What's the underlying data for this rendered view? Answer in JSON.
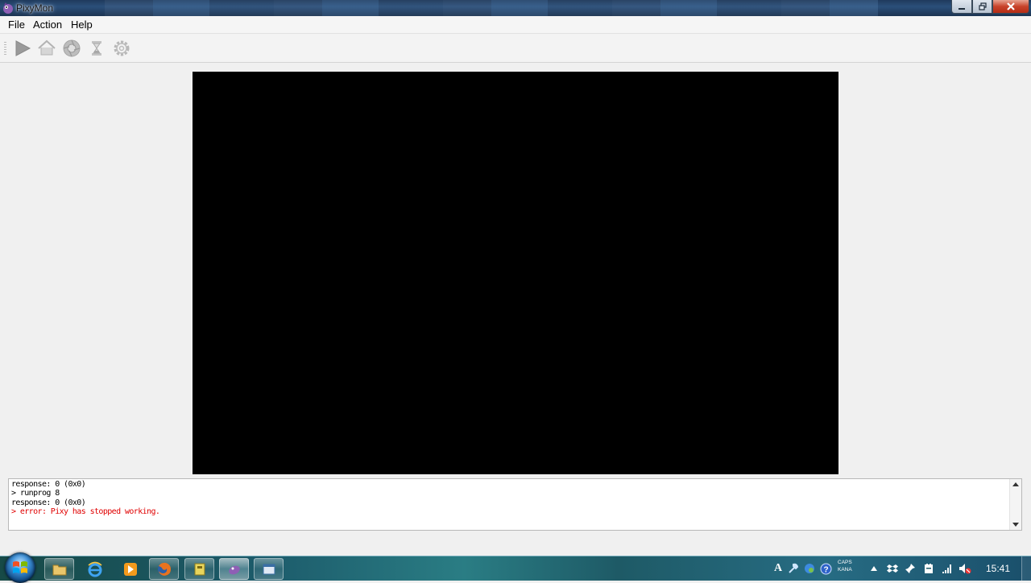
{
  "window": {
    "title": "PixyMon",
    "controls": [
      "minimize",
      "maximize",
      "close"
    ]
  },
  "menu": {
    "items": [
      "File",
      "Action",
      "Help"
    ]
  },
  "toolbar": {
    "buttons": [
      {
        "name": "run",
        "icon": "play-icon"
      },
      {
        "name": "default-program",
        "icon": "home-icon"
      },
      {
        "name": "raw-video",
        "icon": "camera-icon"
      },
      {
        "name": "set-signature",
        "icon": "hourglass-icon"
      },
      {
        "name": "configure",
        "icon": "gear-icon"
      }
    ]
  },
  "video": {
    "background": "#000000"
  },
  "console": {
    "lines": [
      {
        "text": "response: 0 (0x0)",
        "type": "normal"
      },
      {
        "text": "> runprog 8",
        "type": "command"
      },
      {
        "text": "response: 0 (0x0)",
        "type": "normal"
      },
      {
        "text": "> error: Pixy has stopped working.",
        "type": "error"
      }
    ],
    "error_color": "#e00000"
  },
  "taskbar": {
    "apps": [
      {
        "name": "explorer",
        "icon": "folder-icon"
      },
      {
        "name": "internet-explorer",
        "icon": "ie-icon"
      },
      {
        "name": "media-player",
        "icon": "media-icon"
      },
      {
        "name": "firefox",
        "icon": "firefox-icon"
      },
      {
        "name": "app",
        "icon": "app-icon"
      },
      {
        "name": "pixymon",
        "icon": "pixymon-icon",
        "active": true
      },
      {
        "name": "window",
        "icon": "window-icon"
      }
    ],
    "tray": {
      "ime_top": "CAPS",
      "ime_bottom": "KANA",
      "clock": "15:41"
    }
  }
}
